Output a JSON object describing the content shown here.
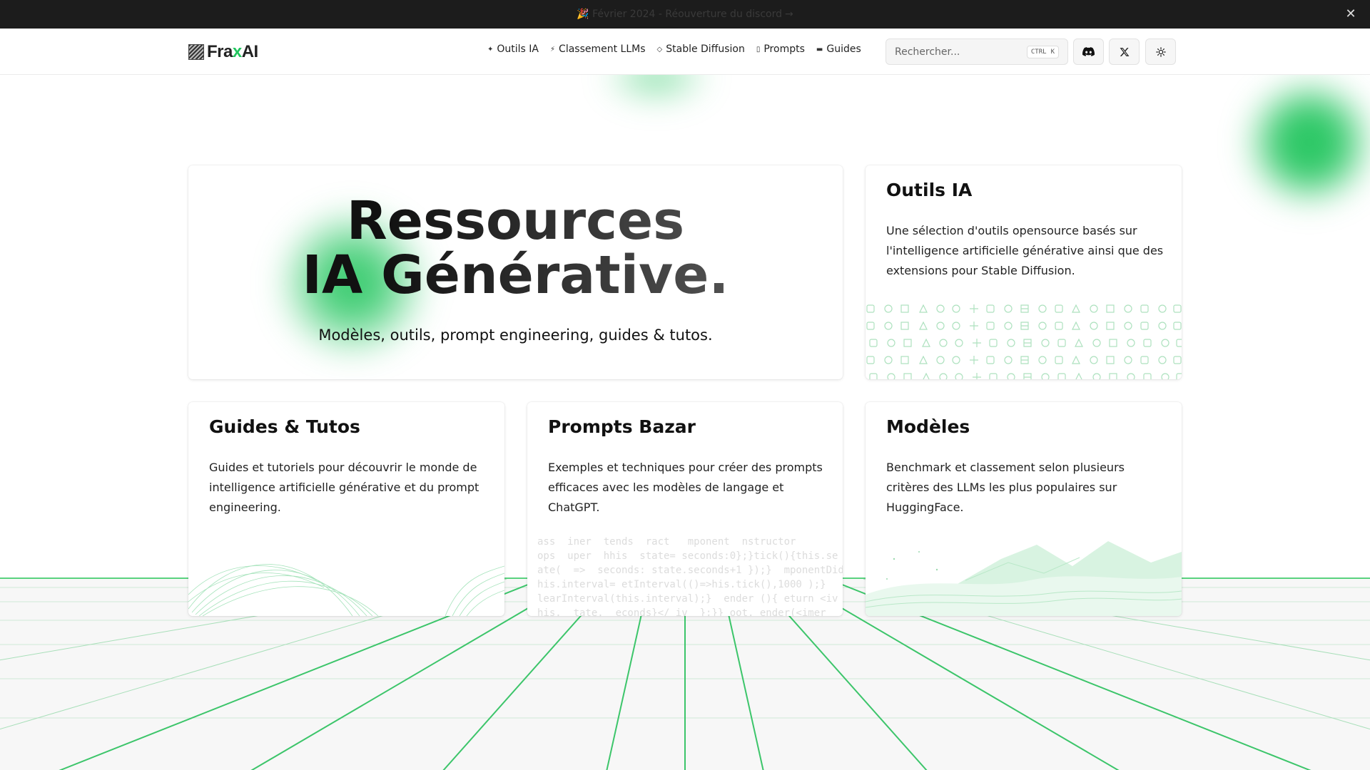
{
  "announcement": {
    "text": "🎉 Février 2024 - Réouverture du discord",
    "arrow": "→",
    "close": "✕"
  },
  "header": {
    "logo": {
      "prefix": "Fra",
      "accent": "x",
      "suffix": "AI"
    },
    "nav": [
      {
        "icon": "sparkles-icon",
        "label": "Outils IA"
      },
      {
        "icon": "bolt-icon",
        "label": "Classement LLMs"
      },
      {
        "icon": "gem-icon",
        "label": "Stable Diffusion"
      },
      {
        "icon": "file-icon",
        "label": "Prompts"
      },
      {
        "icon": "book-icon",
        "label": "Guides"
      }
    ],
    "search": {
      "placeholder": "Rechercher...",
      "shortcut_mod": "CTRL",
      "shortcut_key": "K"
    },
    "buttons": [
      "discord-icon",
      "x-icon",
      "sun-icon"
    ]
  },
  "hero": {
    "title_line1": "Ressources",
    "title_line2": "IA Générative.",
    "subtitle": "Modèles, outils, prompt engineering, guides & tutos."
  },
  "cards": {
    "outils": {
      "title": "Outils IA",
      "desc": "Une sélection d'outils opensource basés sur l'intelligence artificielle générative ainsi que des extensions pour Stable Diffusion."
    },
    "guides": {
      "title": "Guides & Tutos",
      "desc": "Guides et tutoriels pour découvrir le monde de intelligence artificielle générative et du prompt engineering."
    },
    "prompts": {
      "title": "Prompts Bazar",
      "desc": "Exemples et techniques pour créer des prompts efficaces avec les modèles de langage et ChatGPT."
    },
    "modeles": {
      "title": "Modèles",
      "desc": "Benchmark et classement selon plusieurs critères des LLMs les plus populaires sur HuggingFace."
    }
  },
  "colors": {
    "accent": "#22c55e",
    "announce_bg": "#1c1c1c"
  }
}
